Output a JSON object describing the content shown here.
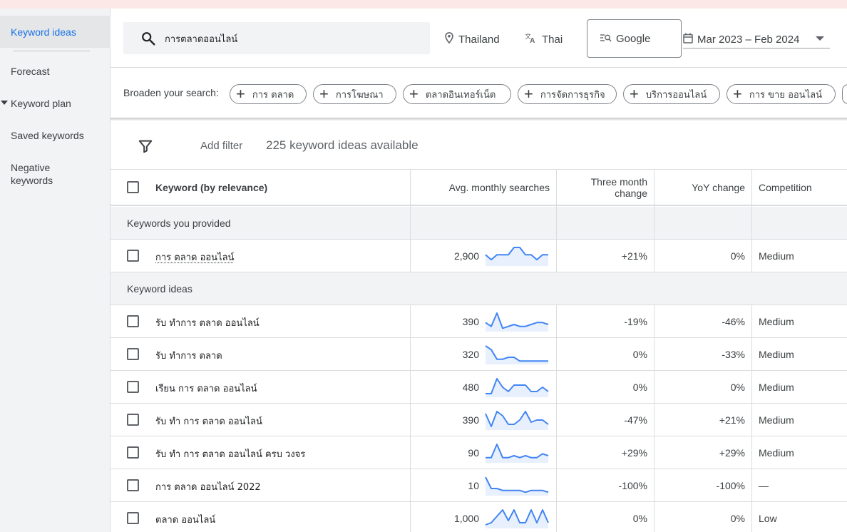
{
  "sidebar": {
    "items": [
      {
        "label": "Keyword ideas",
        "active": true
      },
      {
        "label": "Forecast"
      },
      {
        "label": "Keyword plan",
        "expandable": true
      },
      {
        "label": "Saved keywords"
      },
      {
        "label": "Negative keywords"
      }
    ]
  },
  "search": {
    "value": "การตลาดออนไลน์"
  },
  "filters": {
    "location": "Thailand",
    "language": "Thai",
    "network": "Google",
    "date_range": "Mar 2023 – Feb 2024"
  },
  "broaden": {
    "label": "Broaden your search:",
    "pills": [
      "การ ตลาด",
      "การโฆษณา",
      "ตลาดอินเทอร์เน็ต",
      "การจัดการธุรกิจ",
      "บริการออนไลน์",
      "การ ขาย ออนไลน์"
    ]
  },
  "toolbar": {
    "add_filter": "Add filter",
    "count_text": "225 keyword ideas available"
  },
  "table": {
    "headers": {
      "keyword": "Keyword (by relevance)",
      "avg": "Avg. monthly searches",
      "three_line1": "Three month",
      "three_line2": "change",
      "yoy": "YoY change",
      "competition": "Competition"
    },
    "group_provided": "Keywords you provided",
    "group_ideas": "Keyword ideas",
    "provided_rows": [
      {
        "keyword": "การ ตลาด ออนไลน์",
        "avg": "2,900",
        "three": "+21%",
        "yoy": "0%",
        "competition": "Medium",
        "trend": [
          4,
          2,
          4,
          4,
          4,
          7,
          7,
          4,
          4,
          2,
          4,
          4
        ]
      }
    ],
    "idea_rows": [
      {
        "keyword": "รับ ทําการ ตลาด ออนไลน์",
        "avg": "390",
        "three": "-19%",
        "yoy": "-46%",
        "competition": "Medium",
        "trend": [
          4,
          2,
          9,
          1,
          2,
          3,
          2,
          2,
          3,
          4,
          4,
          3
        ]
      },
      {
        "keyword": "รับ ทําการ ตลาด",
        "avg": "320",
        "three": "0%",
        "yoy": "-33%",
        "competition": "Medium",
        "trend": [
          9,
          7,
          2,
          2,
          3,
          3,
          1,
          1,
          1,
          1,
          1,
          1
        ]
      },
      {
        "keyword": "เรียน การ ตลาด ออนไลน์",
        "avg": "480",
        "three": "0%",
        "yoy": "0%",
        "competition": "Medium",
        "trend": [
          1,
          1,
          8,
          4,
          2,
          5,
          5,
          5,
          2,
          2,
          4,
          2
        ]
      },
      {
        "keyword": "รับ ทํา การ ตลาด ออนไลน์",
        "avg": "390",
        "three": "-47%",
        "yoy": "+21%",
        "competition": "Medium",
        "trend": [
          7,
          1,
          8,
          6,
          2,
          2,
          4,
          8,
          3,
          4,
          4,
          2
        ]
      },
      {
        "keyword": "รับ ทํา การ ตลาด ออนไลน์ ครบ วงจร",
        "avg": "90",
        "three": "+29%",
        "yoy": "+29%",
        "competition": "Medium",
        "trend": [
          2,
          2,
          9,
          2,
          2,
          3,
          2,
          3,
          2,
          2,
          4,
          3
        ]
      },
      {
        "keyword": "การ ตลาด ออนไลน์ 2022",
        "avg": "10",
        "three": "-100%",
        "yoy": "-100%",
        "competition": "—",
        "trend": [
          9,
          3,
          3,
          2,
          2,
          2,
          2,
          1,
          2,
          2,
          2,
          1
        ]
      },
      {
        "keyword": "ตลาด ออนไลน์",
        "avg": "1,000",
        "three": "0%",
        "yoy": "0%",
        "competition": "Low",
        "trend": [
          1,
          2,
          5,
          8,
          3,
          8,
          2,
          2,
          8,
          2,
          8,
          2
        ]
      }
    ]
  },
  "colors": {
    "accent": "#1a73e8",
    "spark_line": "#4285f4",
    "spark_fill": "#e8f0fe"
  },
  "icons": [
    "search-icon",
    "location-pin-icon",
    "translate-icon",
    "search-network-icon",
    "calendar-icon",
    "filter-funnel-icon",
    "plus-icon",
    "checkbox-icon",
    "chevron-down-icon"
  ]
}
